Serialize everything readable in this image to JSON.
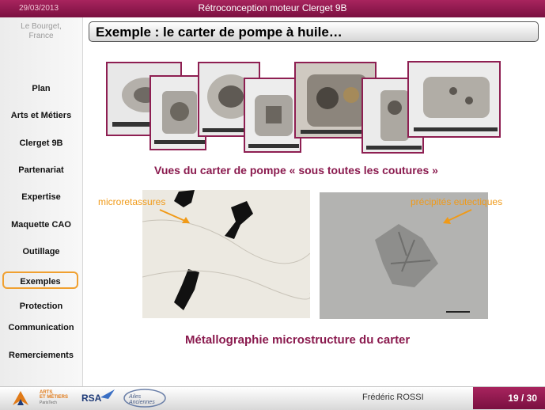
{
  "header": {
    "date": "29/03/2013",
    "title": "Rétroconception moteur Clerget 9B"
  },
  "sidebar": {
    "location_line1": "Le Bourget,",
    "location_line2": "France",
    "items": [
      {
        "label": "Plan"
      },
      {
        "label": "Arts et Métiers"
      },
      {
        "label": "Clerget 9B"
      },
      {
        "label": "Partenariat"
      },
      {
        "label": "Expertise"
      },
      {
        "label": "Maquette CAO"
      },
      {
        "label": "Outillage"
      },
      {
        "label": "Exemples",
        "active": true
      },
      {
        "label": "Protection"
      },
      {
        "label": "Communication"
      },
      {
        "label": "Remerciements"
      }
    ]
  },
  "slide": {
    "title": "Exemple : le carter de pompe à huile…",
    "photos_caption": "Vues du carter de pompe « sous toutes les coutures »",
    "label_left": "microretassures",
    "label_right": "précipités eutectiques",
    "micro_caption": "Métallographie microstructure du carter"
  },
  "footer": {
    "author": "Frédéric ROSSI",
    "page": "19 / 30",
    "logo1_line1": "ARTS",
    "logo1_line2": "ET MÉTIERS",
    "logo1_line3": "ParisTech",
    "logo2": "RSA",
    "logo3": "Ailes Anciennes"
  },
  "colors": {
    "brand": "#8e1f52",
    "accent_orange": "#f09a18"
  }
}
